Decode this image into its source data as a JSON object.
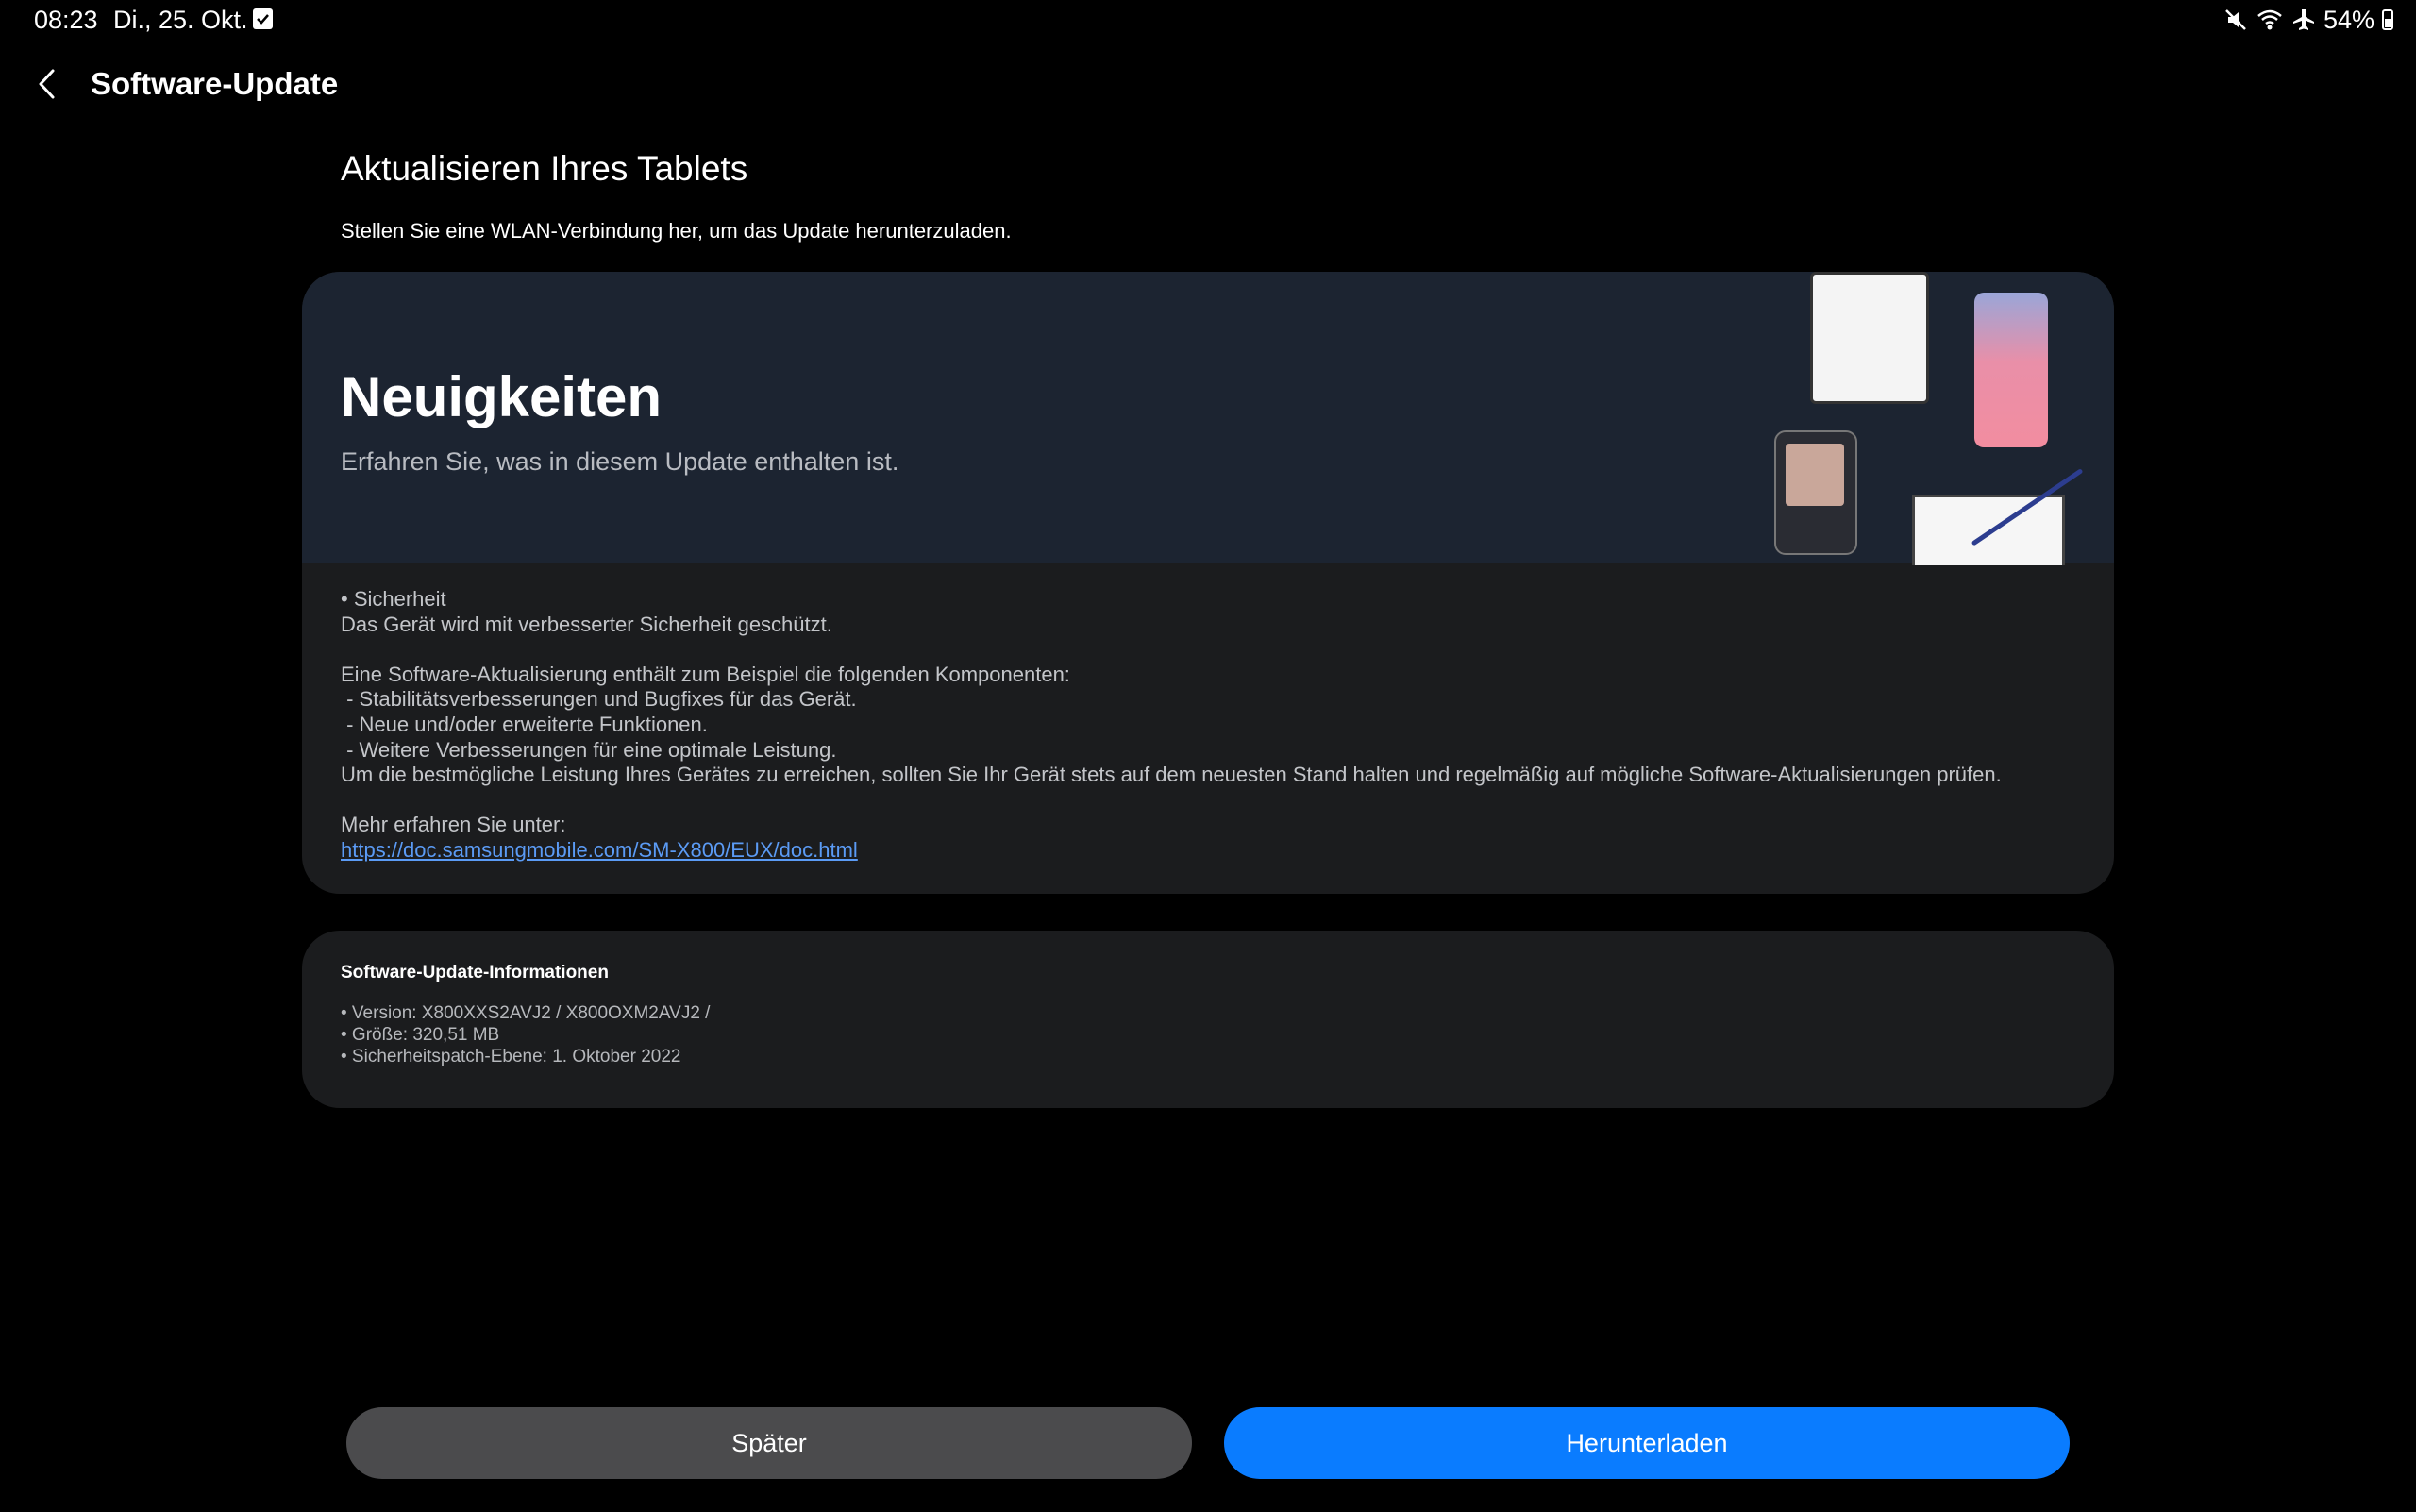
{
  "status_bar": {
    "time": "08:23",
    "date": "Di., 25. Okt.",
    "battery": "54%"
  },
  "header": {
    "title": "Software-Update"
  },
  "section": {
    "title": "Aktualisieren Ihres Tablets",
    "subtitle": "Stellen Sie eine WLAN-Verbindung her, um das Update herunterzuladen."
  },
  "news": {
    "title": "Neuigkeiten",
    "subtitle": "Erfahren Sie, was in diesem Update enthalten ist.",
    "lines": [
      "• Sicherheit",
      "Das Gerät wird mit verbesserter Sicherheit geschützt.",
      "Eine Software-Aktualisierung enthält zum Beispiel die folgenden Komponenten:",
      " - Stabilitätsverbesserungen und Bugfixes für das Gerät.",
      " - Neue und/oder erweiterte Funktionen.",
      " - Weitere Verbesserungen für eine optimale Leistung.",
      "Um die bestmögliche Leistung Ihres Gerätes zu erreichen, sollten Sie Ihr Gerät stets auf dem neuesten Stand halten und regelmäßig auf mögliche Software-Aktualisierungen prüfen.",
      "Mehr erfahren Sie unter:"
    ],
    "link": "https://doc.samsungmobile.com/SM-X800/EUX/doc.html"
  },
  "info": {
    "title": "Software-Update-Informationen",
    "version": "• Version: X800XXS2AVJ2 / X800OXM2AVJ2 /",
    "size": "• Größe: 320,51 MB",
    "patch": "• Sicherheitspatch-Ebene: 1. Oktober 2022"
  },
  "buttons": {
    "later": "Später",
    "download": "Herunterladen"
  },
  "colors": {
    "background": "#000000",
    "card": "#1b1c1e",
    "banner": "#1c2431",
    "primary_button": "#0a7cff",
    "secondary_button": "#4b4b4d",
    "link": "#5b9bf5"
  },
  "icons": [
    "back-arrow-icon",
    "checklist-icon",
    "mute-icon",
    "wifi-icon",
    "airplane-icon",
    "battery-icon"
  ]
}
